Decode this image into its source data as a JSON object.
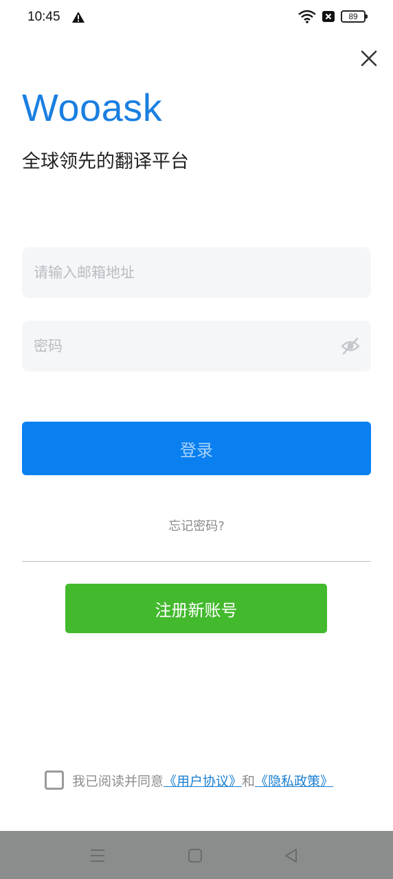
{
  "status_bar": {
    "time": "10:45",
    "battery": "89",
    "icons": [
      "warning-icon",
      "wifi-icon",
      "sim-off-icon",
      "battery-icon"
    ]
  },
  "header": {
    "close_icon": "close-icon"
  },
  "brand": {
    "name": "Wooask",
    "slogan": "全球领先的翻译平台",
    "color": "#1a7fe0"
  },
  "form": {
    "email_placeholder": "请输入邮箱地址",
    "email_value": "",
    "password_placeholder": "密码",
    "password_value": "",
    "password_toggle_icon": "eye-off-icon",
    "login_label": "登录",
    "forgot_label": "忘记密码?",
    "register_label": "注册新账号"
  },
  "agreement": {
    "prefix": "我已阅读并同意",
    "user_agreement": "《用户协议》",
    "and": "和",
    "privacy_policy": "《隐私政策》",
    "checked": false
  },
  "colors": {
    "login_button": "#0a80f0",
    "register_button": "#43b92e",
    "nav_bar": "#8b8d8c"
  },
  "nav_bar": {
    "icons": [
      "menu-icon",
      "home-square-icon",
      "back-triangle-icon"
    ]
  }
}
